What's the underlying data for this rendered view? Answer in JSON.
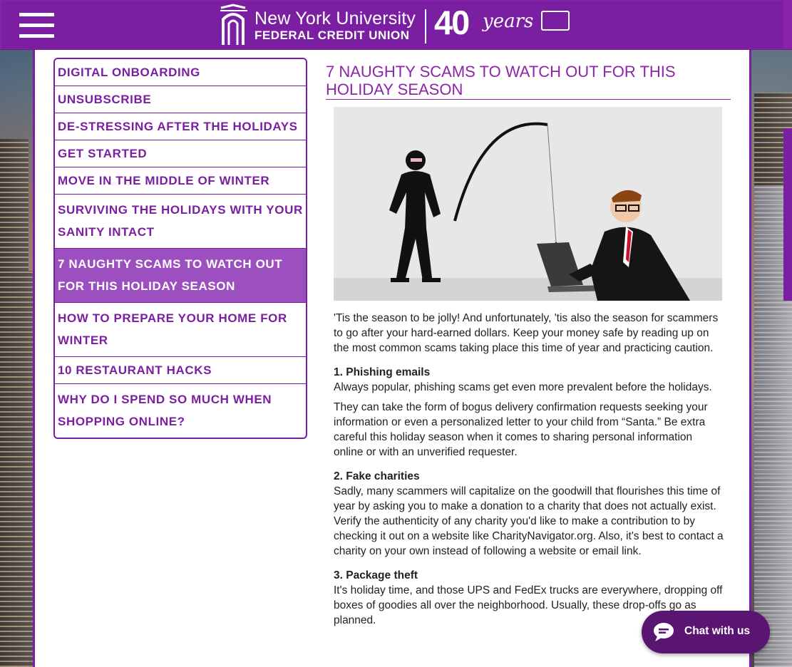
{
  "header": {
    "menu_icon": "hamburger-menu-icon",
    "logo": {
      "name": "New York University",
      "subtitle": "FEDERAL CREDIT UNION",
      "anniversary_number": "40",
      "anniversary_word": "years"
    },
    "brand_color": "#7b1fa2"
  },
  "sidebar": {
    "items": [
      {
        "label": "DIGITAL ONBOARDING",
        "active": false
      },
      {
        "label": "UNSUBSCRIBE",
        "active": false
      },
      {
        "label": "DE-STRESSING AFTER THE HOLIDAYS",
        "active": false
      },
      {
        "label": "GET STARTED",
        "active": false
      },
      {
        "label": "MOVE IN THE MIDDLE OF WINTER",
        "active": false
      },
      {
        "label": "SURVIVING THE HOLIDAYS WITH YOUR SANITY INTACT",
        "active": false
      },
      {
        "label": "7 NAUGHTY SCAMS TO WATCH OUT FOR THIS HOLIDAY SEASON",
        "active": true
      },
      {
        "label": "HOW TO PREPARE YOUR HOME FOR WINTER",
        "active": false
      },
      {
        "label": "10 RESTAURANT HACKS",
        "active": false
      },
      {
        "label": "WHY DO I SPEND SO MUCH WHEN SHOPPING ONLINE?",
        "active": false
      }
    ]
  },
  "article": {
    "title": "7 NAUGHTY SCAMS TO WATCH OUT FOR THIS HOLIDAY SEASON",
    "intro": "'Tis the season to be jolly! And unfortunately, 'tis also the season for scammers to go after your hard-earned dollars. Keep your money safe by reading up on the most common scams taking place this time of year and practicing caution.",
    "sections": [
      {
        "heading": "1. Phishing emails",
        "paragraphs": [
          "Always popular, phishing scams get even more prevalent before the holidays.",
          "They can take the form of bogus delivery confirmation requests seeking your information or even a personalized letter to your child from “Santa.” Be extra careful this holiday season when it comes to sharing personal information online or with an unverified requester."
        ]
      },
      {
        "heading": "2. Fake charities",
        "paragraphs": [
          "Sadly, many scammers will capitalize on the goodwill that flourishes this time of year by asking you to make a donation to a charity that does not actually exist. Verify the authenticity of any charity you'd like to make a contribution to by checking it out on a website like CharityNavigator.org. Also, it's best to contact a charity on your own instead of following a website or email link."
        ]
      },
      {
        "heading": "3. Package theft",
        "paragraphs": [
          "It's holiday time, and those UPS and FedEx trucks are everywhere, dropping off boxes of goodies all over the neighborhood. Usually, these drop-offs go as planned."
        ]
      }
    ]
  },
  "chat": {
    "label": "Chat with us",
    "icon": "chat-bubble-icon"
  }
}
